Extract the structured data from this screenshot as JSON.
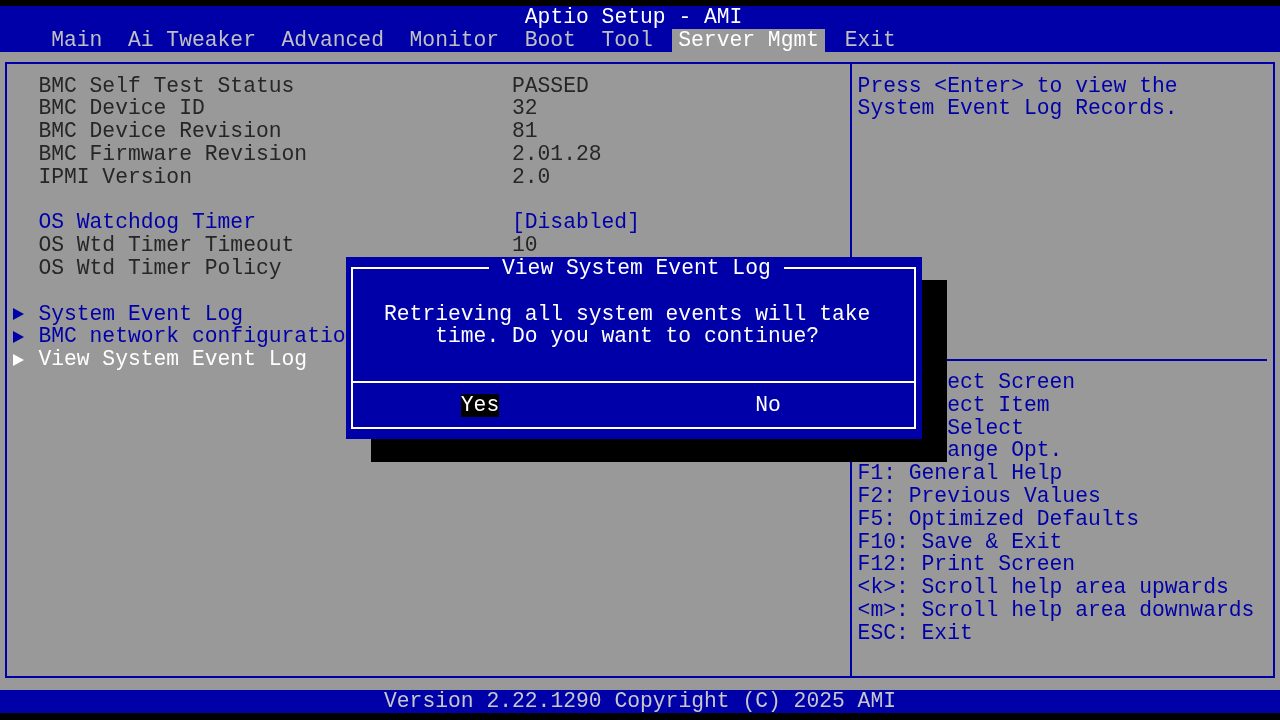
{
  "window": {
    "title": "Aptio Setup - AMI"
  },
  "tabs": [
    {
      "label": "Main",
      "selected": false
    },
    {
      "label": "Ai Tweaker",
      "selected": false
    },
    {
      "label": "Advanced",
      "selected": false
    },
    {
      "label": "Monitor",
      "selected": false
    },
    {
      "label": "Boot",
      "selected": false
    },
    {
      "label": "Tool",
      "selected": false
    },
    {
      "label": "Server Mgmt",
      "selected": true
    },
    {
      "label": "Exit",
      "selected": false
    }
  ],
  "sections": [
    {
      "items": [
        {
          "kind": "info",
          "label": "BMC Self Test Status",
          "value": "PASSED",
          "selected": false
        },
        {
          "kind": "info",
          "label": "BMC Device ID",
          "value": "32",
          "selected": false
        },
        {
          "kind": "info",
          "label": "BMC Device Revision",
          "value": "81",
          "selected": false
        },
        {
          "kind": "info",
          "label": "BMC Firmware Revision",
          "value": "2.01.28",
          "selected": false
        },
        {
          "kind": "info",
          "label": "IPMI Version",
          "value": "2.0",
          "selected": false
        }
      ]
    },
    {
      "items": [
        {
          "kind": "option",
          "label": "OS Watchdog Timer",
          "value": "[Disabled]",
          "selected": false
        },
        {
          "kind": "info",
          "label": "OS Wtd Timer Timeout",
          "value": "10",
          "selected": false
        },
        {
          "kind": "info",
          "label": "OS Wtd Timer Policy",
          "selected": false
        }
      ]
    },
    {
      "items": [
        {
          "kind": "submenu",
          "label": "System Event Log",
          "selected": false
        },
        {
          "kind": "submenu",
          "label": "BMC network configuratio",
          "selected": false
        },
        {
          "kind": "submenu",
          "label": "View System Event Log",
          "selected": true
        }
      ]
    }
  ],
  "help": {
    "text": "Press <Enter> to view the System Event Log Records."
  },
  "hotkeys": [
    {
      "kind": "clipped",
      "text": "ect Screen"
    },
    {
      "kind": "clipped",
      "text": "ect Item"
    },
    {
      "kind": "clipped",
      "text": "Select"
    },
    {
      "kind": "clipped",
      "text": "ange Opt."
    },
    {
      "kind": "key",
      "text": "F1: General Help"
    },
    {
      "kind": "key",
      "text": "F2: Previous Values"
    },
    {
      "kind": "key",
      "text": "F5: Optimized Defaults"
    },
    {
      "kind": "key",
      "text": "F10: Save & Exit"
    },
    {
      "kind": "key",
      "text": "F12: Print Screen"
    },
    {
      "kind": "key",
      "text": "<k>: Scroll help area upwards"
    },
    {
      "kind": "key",
      "text": "<m>: Scroll help area downwards"
    },
    {
      "kind": "key",
      "text": "ESC: Exit"
    }
  ],
  "dialog": {
    "title": "View System Event Log",
    "message": "Retrieving all system events will take time. Do you want to continue?",
    "buttons": [
      {
        "label": "Yes",
        "selected": true
      },
      {
        "label": "No",
        "selected": false
      }
    ]
  },
  "status_bar": {
    "text": "Version 2.22.1290 Copyright (C) 2025 AMI"
  }
}
